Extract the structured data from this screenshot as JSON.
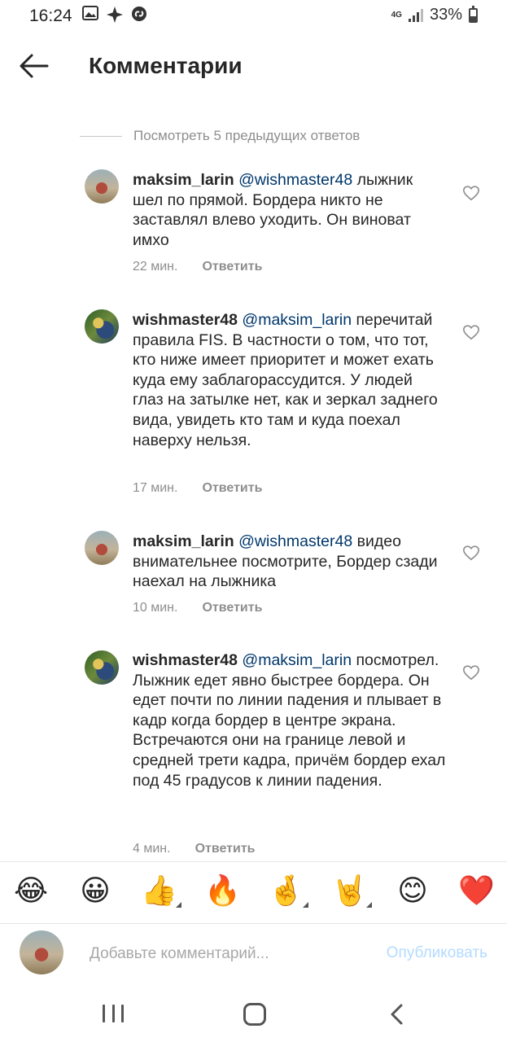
{
  "status_bar": {
    "time": "16:24",
    "network": "4G",
    "battery": "33%",
    "left_icons": [
      "gallery-icon",
      "sparkle-icon",
      "shazam-icon"
    ]
  },
  "header": {
    "title": "Комментарии",
    "back_icon": "arrow-left-icon"
  },
  "view_previous": "Посмотреть 5 предыдущих ответов",
  "comments": [
    {
      "username": "maksim_larin",
      "mention": "@wishmaster48",
      "text": " лыжник шел по прямой. Бордера никто не заставлял влево уходить. Он виноват имхо",
      "time": "22 мин.",
      "reply": "Ответить"
    },
    {
      "username": "wishmaster48",
      "mention": "@maksim_larin",
      "text": " перечитай правила FIS. В частности о том, что тот, кто ниже имеет приоритет и может ехать куда ему заблагорассудится. У людей глаз на затылке нет, как и зеркал заднего вида, увидеть кто там и куда поехал наверху нельзя.",
      "time": "17 мин.",
      "reply": "Ответить"
    },
    {
      "username": "maksim_larin",
      "mention": "@wishmaster48",
      "text": " видео внимательнее посмотрите, Бордер сзади наехал на лыжника",
      "time": "10 мин.",
      "reply": "Ответить"
    },
    {
      "username": "wishmaster48",
      "mention": "@maksim_larin",
      "text": " посмотрел. Лыжник едет явно быстрее бордера. Он едет почти по линии падения и  плывает в кадр когда бордер в центре экрана. Встречаются они на границе левой и средней трети кадра, причём бордер ехал под 45 градусов к линии падения.",
      "time": "4 мин.",
      "reply": "Ответить"
    }
  ],
  "emoji_bar": [
    "😂",
    "😀",
    "👍",
    "🔥",
    "🤞",
    "🤘",
    "😊",
    "❤️"
  ],
  "input": {
    "placeholder": "Добавьте комментарий...",
    "publish": "Опубликовать"
  },
  "colors": {
    "mention": "#00376b",
    "meta": "#8e8e8e",
    "publish_disabled": "#b3dbff",
    "heart": "#ed1c24"
  }
}
